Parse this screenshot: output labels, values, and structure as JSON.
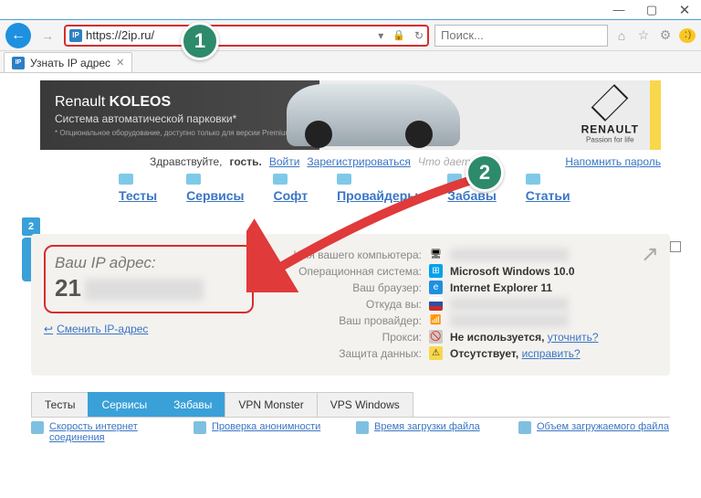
{
  "window": {
    "tab_title": "Узнать IP адрес"
  },
  "address_bar": {
    "url": "https://2ip.ru/"
  },
  "search": {
    "placeholder": "Поиск..."
  },
  "banner": {
    "title_prefix": "Renault ",
    "title_bold": "KOLEOS",
    "subtitle": "Система автоматической парковки*",
    "note": "* Опциональное оборудование, доступно только для версии Premium.",
    "brand_name": "RENAULT",
    "brand_tagline": "Passion for life"
  },
  "header": {
    "greeting": "Здравствуйте,",
    "guest": "гость.",
    "login": "Войти",
    "register": "Зарегистрироваться",
    "hint": "Что дает ре",
    "remind": "Напомнить пароль"
  },
  "logo": {
    "badge": "2",
    "text": "IP"
  },
  "nav": [
    "Тесты",
    "Сервисы",
    "Софт",
    "Провайдеры",
    "Забавы",
    "Статьи"
  ],
  "ip": {
    "label": "Ваш IP адрес:",
    "value": "21",
    "change": "Сменить IP-адрес",
    "rows": {
      "computer_name": "Имя вашего компьютера:",
      "os": "Операционная система:",
      "os_val": "Microsoft Windows 10.0",
      "browser": "Ваш браузер:",
      "browser_val": "Internet Explorer 11",
      "from": "Откуда вы:",
      "provider": "Ваш провайдер:",
      "proxy": "Прокси:",
      "proxy_val": "Не используется,",
      "proxy_link": "уточнить?",
      "protection": "Защита данных:",
      "protection_val": "Отсутствует,",
      "protection_link": "исправить?"
    }
  },
  "bottom_tabs": [
    "Тесты",
    "Сервисы",
    "Забавы",
    "VPN Monster",
    "VPS Windows"
  ],
  "bottom_links": [
    "Скорость интернет соединения",
    "Проверка анонимности",
    "Время загрузки файла",
    "Объем загружаемого файла"
  ],
  "annotations": {
    "one": "1",
    "two": "2"
  }
}
